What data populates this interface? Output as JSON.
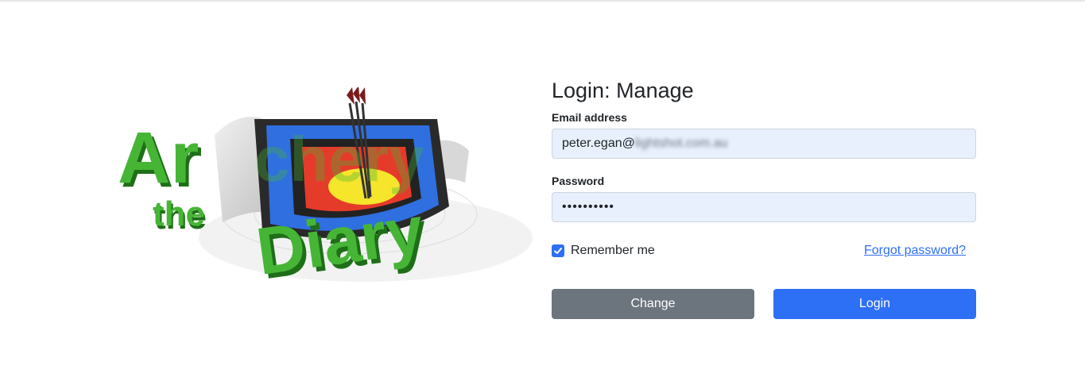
{
  "logo": {
    "line1": "Archery",
    "line2": "the",
    "line3": "Diary",
    "text_color": "#46b536"
  },
  "form": {
    "title": "Login: Manage",
    "email_label": "Email address",
    "email_value_visible": "peter.egan@",
    "email_value_blurred": "lightshot.com.au",
    "password_label": "Password",
    "password_value": "••••••••••",
    "remember_label": "Remember me",
    "remember_checked": true,
    "forgot_link": "Forgot password?",
    "change_button": "Change",
    "login_button": "Login"
  },
  "colors": {
    "primary": "#2d6ff5",
    "secondary": "#6c757d",
    "autofill_bg": "#e8f0fe"
  }
}
